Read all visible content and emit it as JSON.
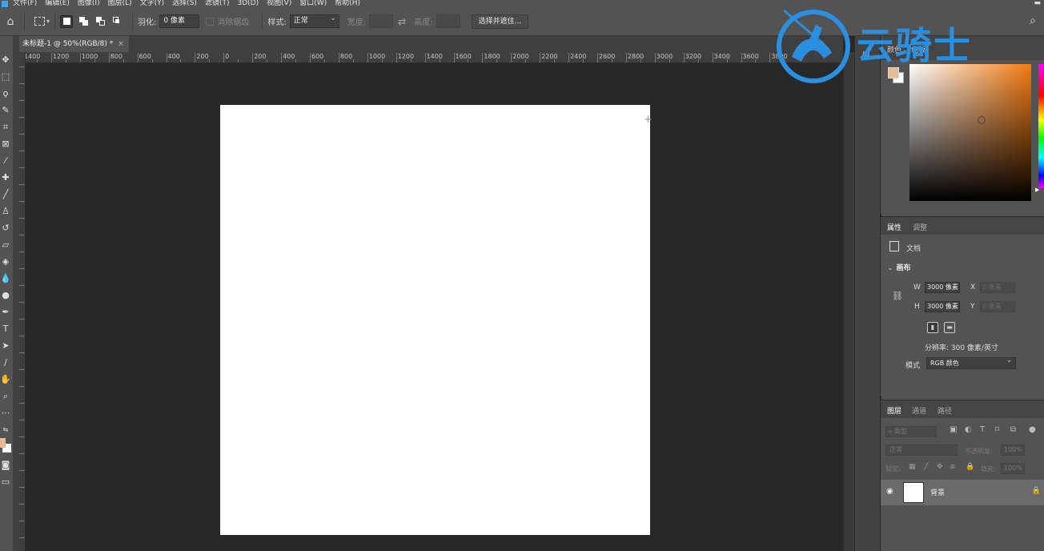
{
  "menu": [
    "文件(F)",
    "编辑(E)",
    "图像(I)",
    "图层(L)",
    "文字(Y)",
    "选择(S)",
    "滤镜(T)",
    "3D(D)",
    "视图(V)",
    "窗口(W)",
    "帮助(H)"
  ],
  "options": {
    "feather_label": "羽化:",
    "feather_value": "0 像素",
    "antialias_label": "消除锯齿",
    "style_label": "样式:",
    "style_value": "正常",
    "width_label": "宽度:",
    "height_label": "高度:",
    "select_mask_button": "选择并遮住..."
  },
  "document": {
    "tab_title": "未标题-1 @ 50%(RGB/8) *",
    "close": "×",
    "ruler_labels": [
      "1400",
      "1200",
      "1000",
      "800",
      "600",
      "400",
      "200",
      "0",
      "200",
      "400",
      "600",
      "800",
      "1000",
      "1200",
      "1400",
      "1600",
      "1800",
      "2000",
      "2200",
      "2400",
      "2600",
      "2800",
      "3000",
      "3200",
      "3400",
      "3600",
      "3800"
    ]
  },
  "color_panel": {
    "tab_color": "颜色",
    "tab_swatches": "色板",
    "foreground": "#e8b898",
    "background": "#ffffff",
    "hue": "#f47a10"
  },
  "properties": {
    "tab_properties": "属性",
    "tab_adjustments": "调整",
    "doc_label": "文档",
    "canvas_section": "画布",
    "w_label": "W",
    "w_value": "3000 像素",
    "h_label": "H",
    "h_value": "3000 像素",
    "x_label": "X",
    "x_placeholder": "0 像素",
    "y_label": "Y",
    "y_placeholder": "0 像素",
    "resolution": "分辨率: 300 像素/英寸",
    "mode_label": "模式",
    "mode_value": "RGB 颜色"
  },
  "layers": {
    "tab_layers": "图层",
    "tab_channels": "通道",
    "tab_paths": "路径",
    "filter_placeholder": "类型",
    "blend_mode": "正常",
    "opacity_label": "不透明度:",
    "opacity_value": "100%",
    "lock_label": "锁定:",
    "fill_label": "填充:",
    "fill_value": "100%",
    "items": [
      {
        "name": "背景"
      }
    ]
  },
  "watermark": {
    "text": "云骑士"
  }
}
